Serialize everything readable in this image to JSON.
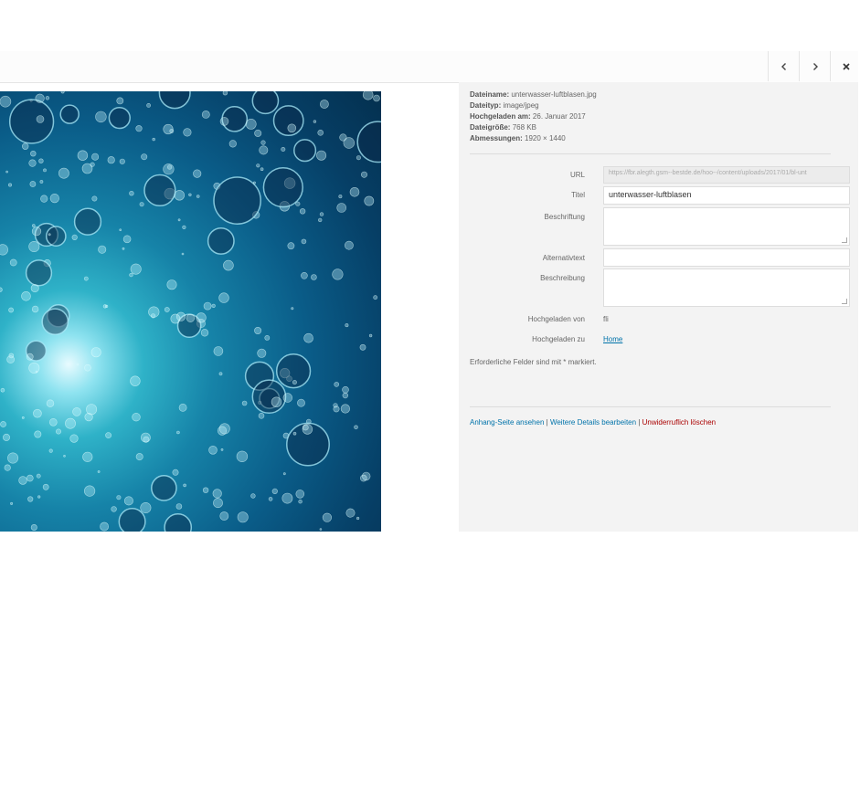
{
  "header": {
    "prev_icon": "chevron-left-icon",
    "next_icon": "chevron-right-icon",
    "close_icon": "close-icon"
  },
  "image": {
    "description_icon": "underwater-bubbles-photo"
  },
  "details": {
    "filename_label": "Dateiname:",
    "filename": "unterwasser-luftblasen.jpg",
    "filetype_label": "Dateityp:",
    "filetype": "image/jpeg",
    "uploaded_label": "Hochgeladen am:",
    "uploaded": "26. Januar 2017",
    "filesize_label": "Dateigröße:",
    "filesize": "768 KB",
    "dimensions_label": "Abmessungen:",
    "dimensions": "1920 × 1440"
  },
  "form": {
    "url_label": "URL",
    "url_value": "https://fbr.alegth.gsm--bestde.de/hoo--/content/uploads/2017/01/bl-unt",
    "title_label": "Titel",
    "title_value": "unterwasser-luftblasen",
    "caption_label": "Beschriftung",
    "caption_value": "",
    "alt_label": "Alternativtext",
    "alt_value": "",
    "description_label": "Beschreibung",
    "description_value": "",
    "uploaded_by_label": "Hochgeladen von",
    "uploaded_by": "fli",
    "uploaded_to_label": "Hochgeladen zu",
    "uploaded_to": "Home"
  },
  "required_note": "Erforderliche Felder sind mit * markiert.",
  "actions": {
    "view_attachment": "Anhang-Seite ansehen",
    "sep1": "|",
    "edit_more": "Weitere Details bearbeiten",
    "sep2": "|",
    "delete": "Unwiderruflich löschen"
  },
  "colors": {
    "link": "#0073aa",
    "delete": "#aa0000",
    "sidebar_bg": "#f3f3f3"
  }
}
